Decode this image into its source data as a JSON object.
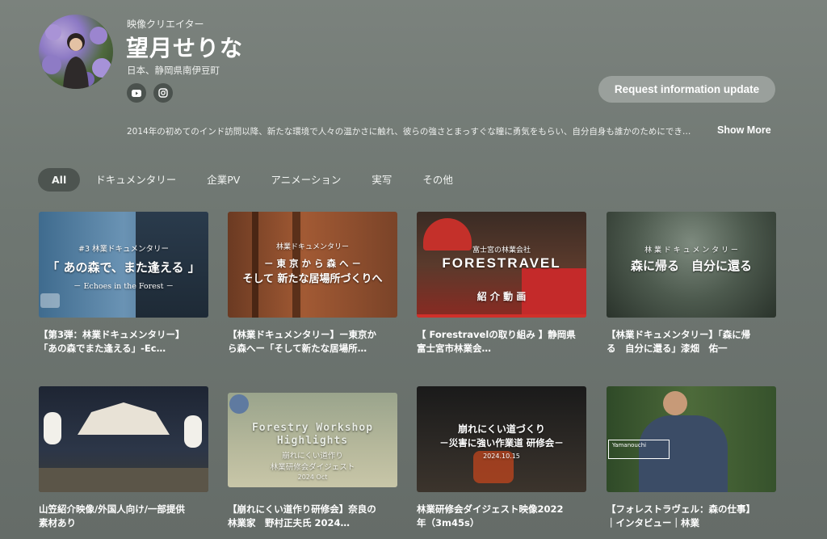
{
  "profile": {
    "role": "映像クリエイター",
    "name": "望月せりな",
    "location": "日本、静岡県南伊豆町",
    "social": [
      "youtube-icon",
      "instagram-icon"
    ],
    "request_button": "Request information update",
    "bio": "2014年の初めてのインド訪問以降、新たな環境で人々の温かさに触れ、彼らの強さとまっすぐな瞳に勇気をもらい、自分自身も誰かのためにでき…",
    "show_more": "Show More"
  },
  "tabs": [
    {
      "label": "All",
      "active": true
    },
    {
      "label": "ドキュメンタリー",
      "active": false
    },
    {
      "label": "企業PV",
      "active": false
    },
    {
      "label": "アニメーション",
      "active": false
    },
    {
      "label": "実写",
      "active": false
    },
    {
      "label": "その他",
      "active": false
    }
  ],
  "videos": [
    {
      "thumb_lines": [
        "#3 林業ドキュメンタリー",
        "「 あの森で、また逢える 」",
        "－ Echoes in the Forest －"
      ],
      "title": [
        "【第3弾：林業ドキュメンタリー】",
        "「あの森でまた逢える」-Ec…"
      ]
    },
    {
      "thumb_lines": [
        "林業ドキュメンタリー",
        "－ 東 京 か ら 森 へ －",
        "そして 新たな居場所づくりへ"
      ],
      "title": [
        "【林業ドキュメンタリー】ー東京か",
        "ら森へー「そして新たな居場所…"
      ]
    },
    {
      "thumb_lines": [
        "富士宮の林業会社",
        "FORESTRAVEL",
        "紹 介 動 画"
      ],
      "title": [
        "【 Forestravelの取り組み 】静岡県",
        "富士宮市林業会…"
      ]
    },
    {
      "thumb_lines": [
        "林 業 ド キ ュ メ ン タ リ ー",
        "森に帰る　自分に還る"
      ],
      "title": [
        "【林業ドキュメンタリー】「森に帰",
        "る　自分に還る」漆畑　佑一"
      ]
    },
    {
      "thumb_lines": [],
      "title": [
        "山笠紹介映像/外国人向け/一部提供",
        "素材あり"
      ]
    },
    {
      "thumb_lines": [
        "Forestry Workshop",
        "Highlights",
        "崩れにくい道作り",
        "林業研修会ダイジェスト",
        "2024 Oct"
      ],
      "title": [
        "【崩れにくい道作り研修会】奈良の",
        "林業家　野村正夫氏 2024…"
      ]
    },
    {
      "thumb_lines": [
        "崩れにくい道づくり",
        "－災害に強い作業道 研修会－",
        "2024.10.15"
      ],
      "title": [
        "林業研修会ダイジェスト映像2022",
        "年（3m45s）"
      ]
    },
    {
      "thumb_lines": [
        "Yamanouchi"
      ],
      "title": [
        "【フォレストラヴェル：森の仕事】",
        "｜インタビュー｜林業"
      ]
    }
  ],
  "colors": {
    "background": "#737a76",
    "active_tab": "#4d5450",
    "button": "#9aa09c"
  }
}
